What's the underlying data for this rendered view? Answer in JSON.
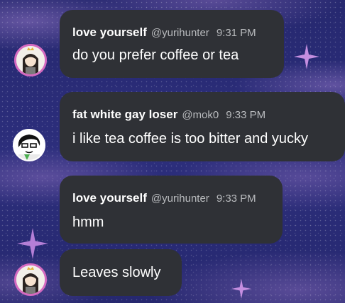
{
  "messages": [
    {
      "author": "love yourself",
      "handle": "@yurihunter",
      "time": "9:31 PM",
      "text": "do you prefer coffee or tea",
      "avatar": "anime-girl-with-crown-avatar"
    },
    {
      "author": "fat white gay loser",
      "handle": "@mok0",
      "time": "9:33 PM",
      "text": "i like tea coffee is too bitter and yucky",
      "avatar": "white-faced-character-with-glasses-avatar"
    },
    {
      "author": "love yourself",
      "handle": "@yurihunter",
      "time": "9:33 PM",
      "text": "hmm",
      "avatar": "anime-girl-with-crown-avatar"
    },
    {
      "text": "Leaves slowly",
      "avatar": "anime-girl-with-crown-avatar"
    }
  ],
  "colors": {
    "bubble": "#2f3136",
    "background": "#2a2c76",
    "muted_text": "#b9bbbe",
    "avatar_ring": "#d46ac0",
    "sparkle": "#c58ee0"
  }
}
